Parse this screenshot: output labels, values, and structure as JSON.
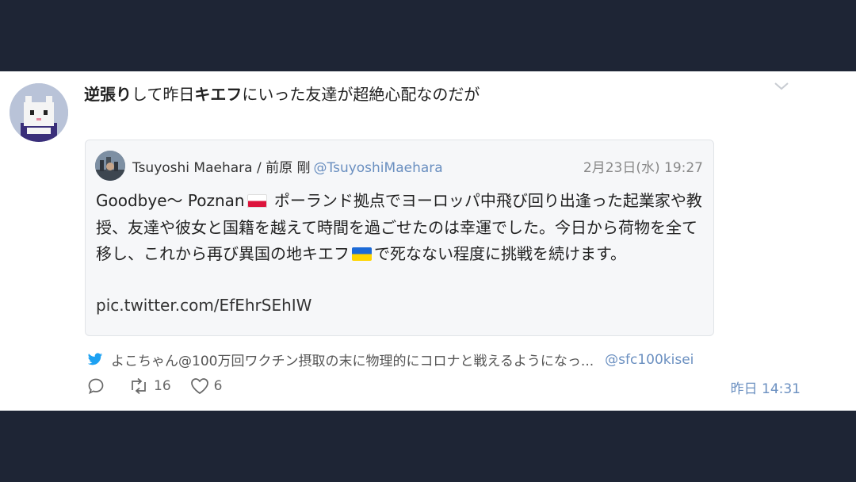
{
  "tweet": {
    "avatar_icon": "pixel-cat-avatar",
    "text_parts": [
      "逆張り",
      "して昨日",
      "キエフ",
      "にいった友達が超絶心配なのだが"
    ],
    "quoted": {
      "author_name": "Tsuyoshi Maehara / 前原 剛",
      "author_handle": "@TsuyoshiMaehara",
      "date": "2月23日(水) 19:27",
      "body_part1": "Goodbye〜 Poznan",
      "body_part2": " ポーランド拠点でヨーロッパ中飛び回り出逢った起業家や教授、友達や彼女と国籍を越えて時間を過ごせたのは幸運でした。今日から荷物を全て移し、これから再び異国の地キエフ",
      "body_part3": "で死なない程度に挑戦を続けます。",
      "link": "pic.twitter.com/EfEhrSEhIW"
    },
    "retweet_context": {
      "text": "よこちゃん@100万回ワクチン摂取の末に物理的にコロナと戦えるようになっ...",
      "handle": "@sfc100kisei"
    },
    "actions": {
      "retweet_count": "16",
      "like_count": "6"
    },
    "timestamp": "昨日 14:31",
    "colors": {
      "background": "#1e2535",
      "link": "#6a8fc0",
      "twitter_blue": "#1da1f2"
    }
  }
}
